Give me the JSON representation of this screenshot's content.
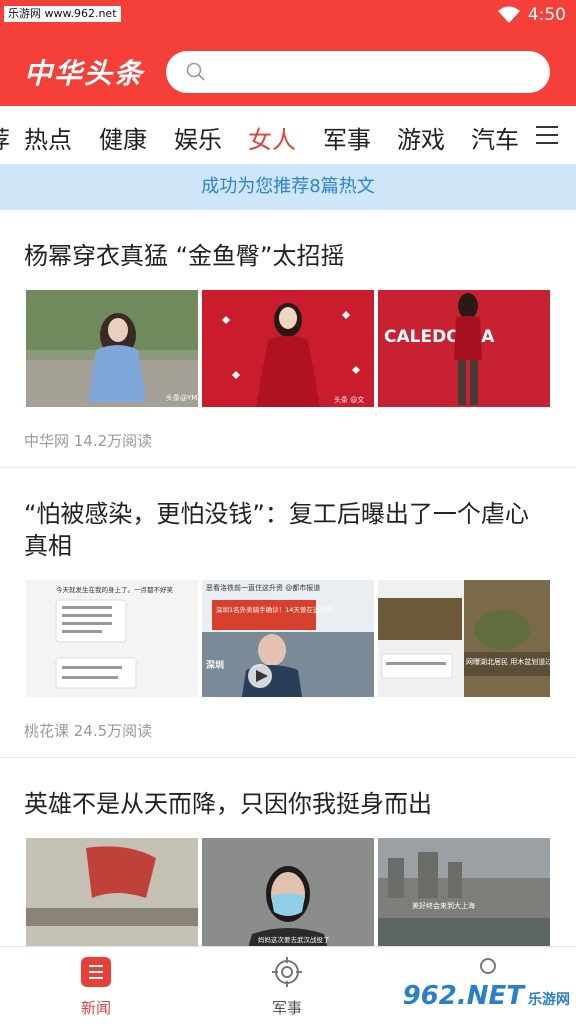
{
  "status_bar": {
    "site": "乐游网 www.962.net",
    "time": "4:50"
  },
  "header": {
    "logo": "中华头条",
    "search_placeholder": ""
  },
  "tabs": {
    "items": [
      "荐",
      "热点",
      "健康",
      "娱乐",
      "女人",
      "军事",
      "游戏",
      "汽车"
    ],
    "active_index": 4
  },
  "banner": {
    "text": "成功为您推荐8篇热文"
  },
  "articles": [
    {
      "title": "杨幂穿衣真猛 “金鱼臀”太招摇",
      "source": "中华网 14.2万阅读"
    },
    {
      "title": "“怕被感染，更怕没钱”：复工后曝出了一个虐心真相",
      "source": "桃花课 24.5万阅读"
    },
    {
      "title": "英雄不是从天而降，只因你我挺身而出",
      "source": ""
    }
  ],
  "thumb_texts": {
    "a1_1": "头条@YMFU",
    "a1_2": "头条 @文",
    "a1_3": "CALEDONIA",
    "a2_1": "今天就发生在我的身上了。一点都不好笑",
    "a2_2a": "恶看洛铁前一直住这升资 @都市报道",
    "a2_2b": "深圳1名外卖骑手确诊！14天曾在送外卖",
    "a2_2c": "深圳",
    "a2_3": "网曝湖北居民 用木盆划道过江回九江",
    "a3_2": "妈妈这次要去武汉战役了",
    "a3_3": "美好终会来到大上海"
  },
  "bottom_nav": {
    "items": [
      {
        "label": "新闻",
        "active": true
      },
      {
        "label": "军事",
        "active": false
      }
    ]
  },
  "watermark": {
    "main": "962.NET",
    "sub": "乐游网"
  },
  "colors": {
    "brand_red": "#f5403a",
    "active_tab": "#e8413a",
    "banner_bg": "#cfe6f8",
    "banner_text": "#2a83d3"
  }
}
